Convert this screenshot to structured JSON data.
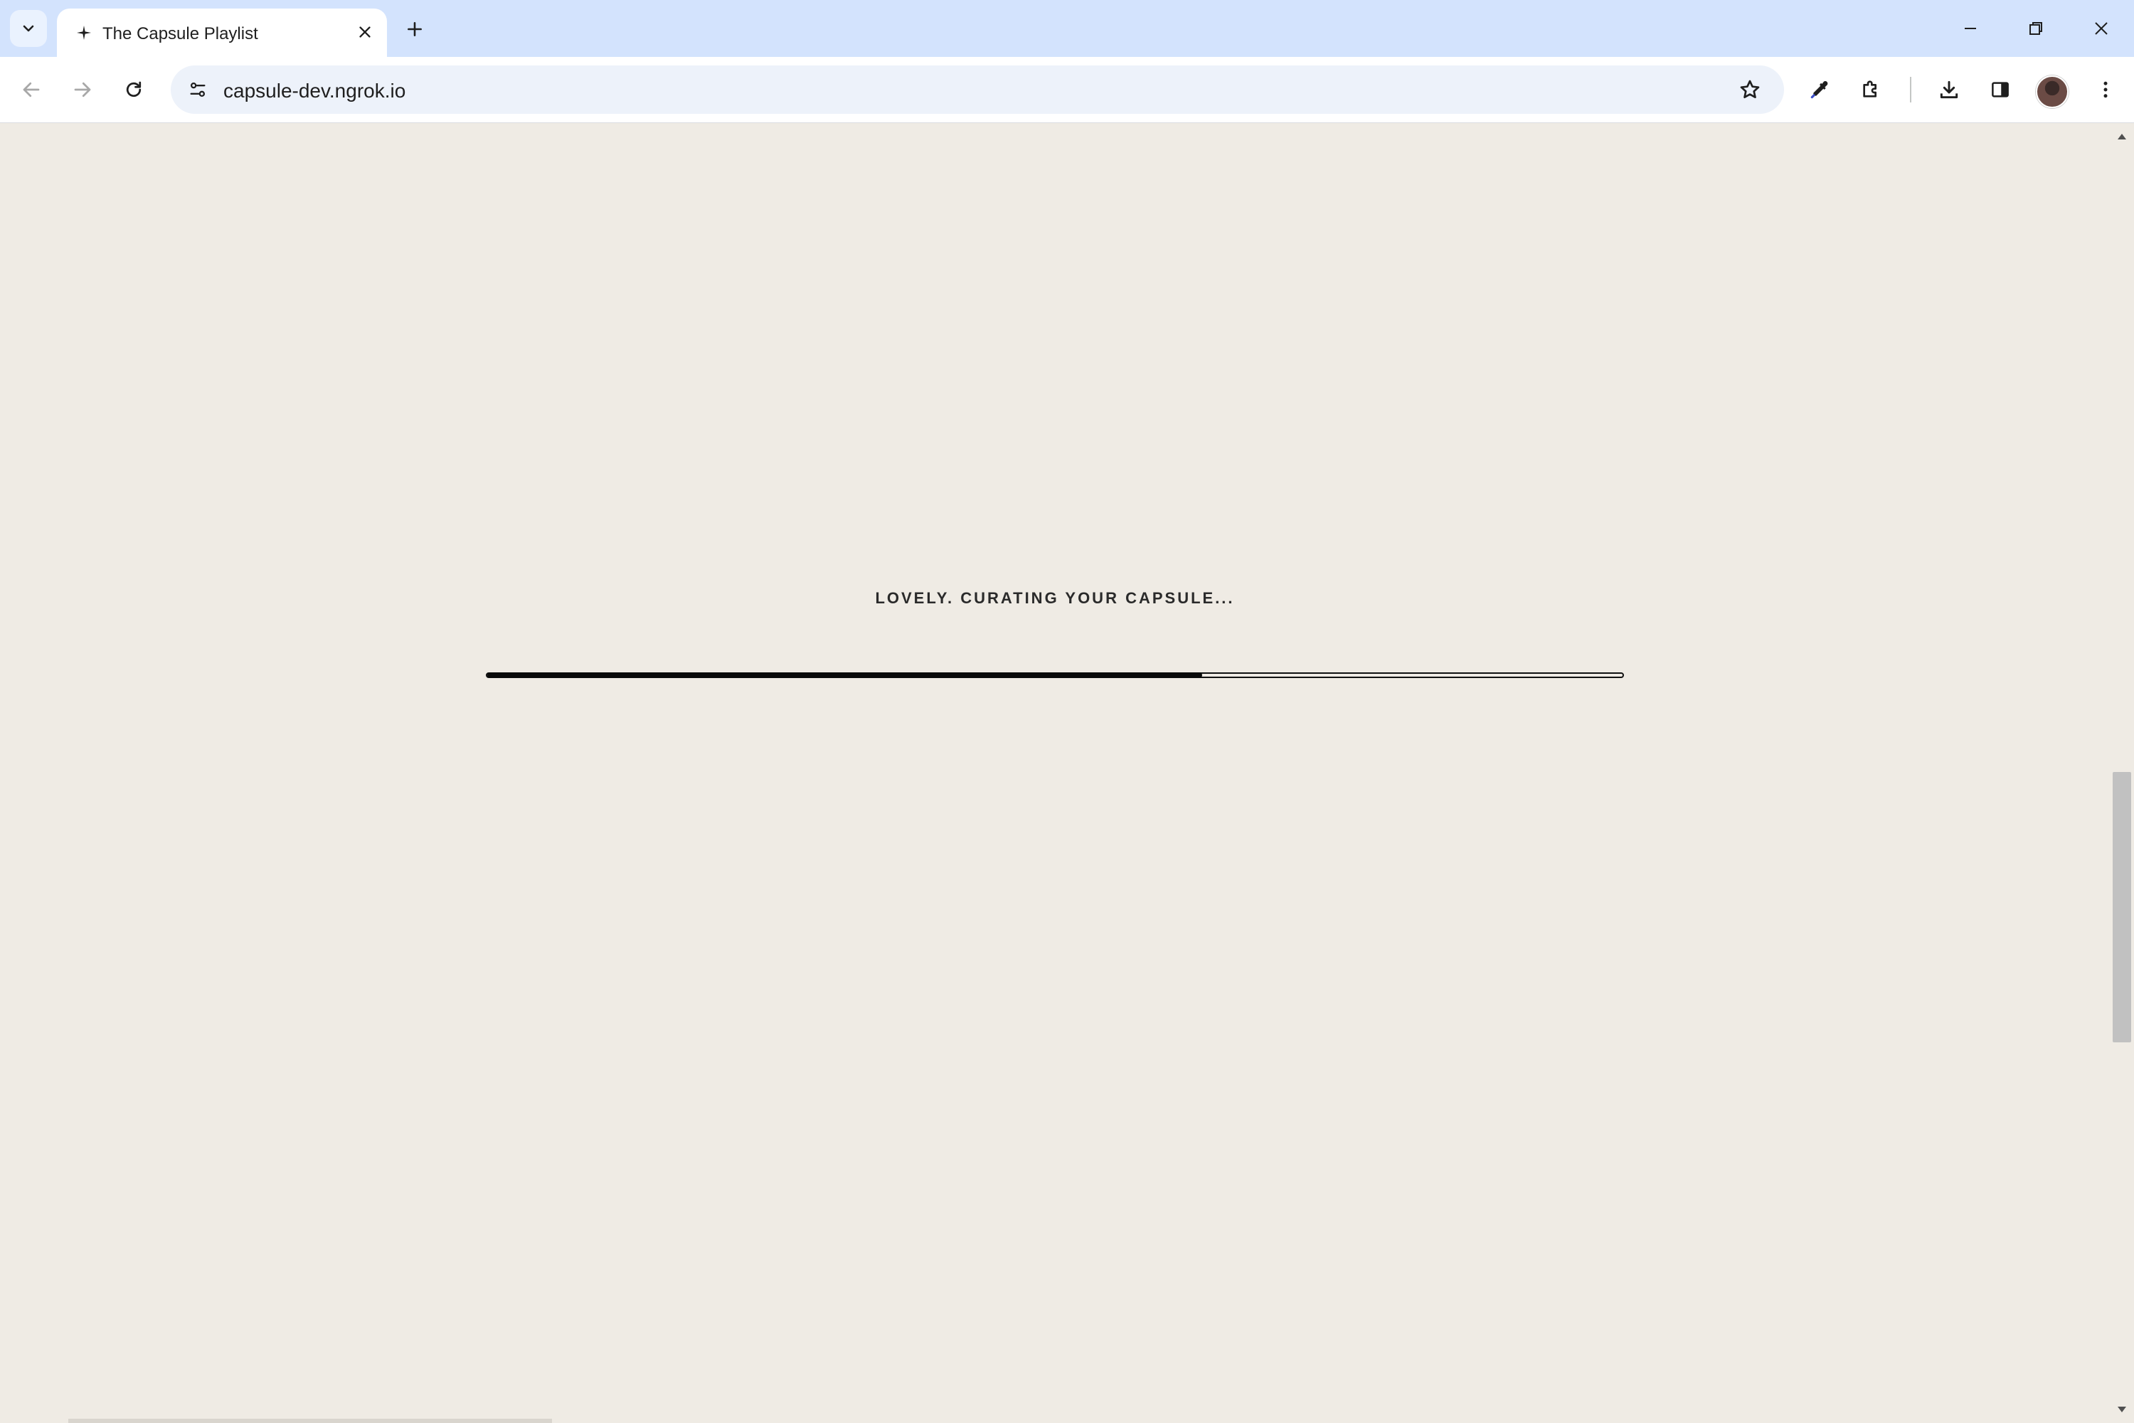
{
  "browser": {
    "tab": {
      "title": "The Capsule Playlist",
      "favicon": "sparkle-icon"
    },
    "address_bar": {
      "url": "capsule-dev.ngrok.io"
    },
    "icons": {
      "tab_search": "chevron-down-icon",
      "tab_close": "close-icon",
      "new_tab": "plus-icon",
      "minimize": "minimize-icon",
      "restore": "restore-icon",
      "close_window": "close-icon",
      "back": "arrow-left-icon",
      "forward": "arrow-right-icon",
      "reload": "reload-icon",
      "site_info": "tune-icon",
      "bookmark": "star-outline-icon",
      "eyedropper": "eyedropper-icon",
      "extensions": "puzzle-icon",
      "downloads": "download-icon",
      "side_panel": "side-panel-icon",
      "profile": "avatar",
      "menu": "more-vert-icon"
    }
  },
  "page": {
    "status_text": "LOVELY. CURATING YOUR CAPSULE...",
    "progress": {
      "percent": 63
    },
    "colors": {
      "background": "#efebe4",
      "progress_fill": "#0a0a0a",
      "text": "#2a2a2a"
    }
  }
}
